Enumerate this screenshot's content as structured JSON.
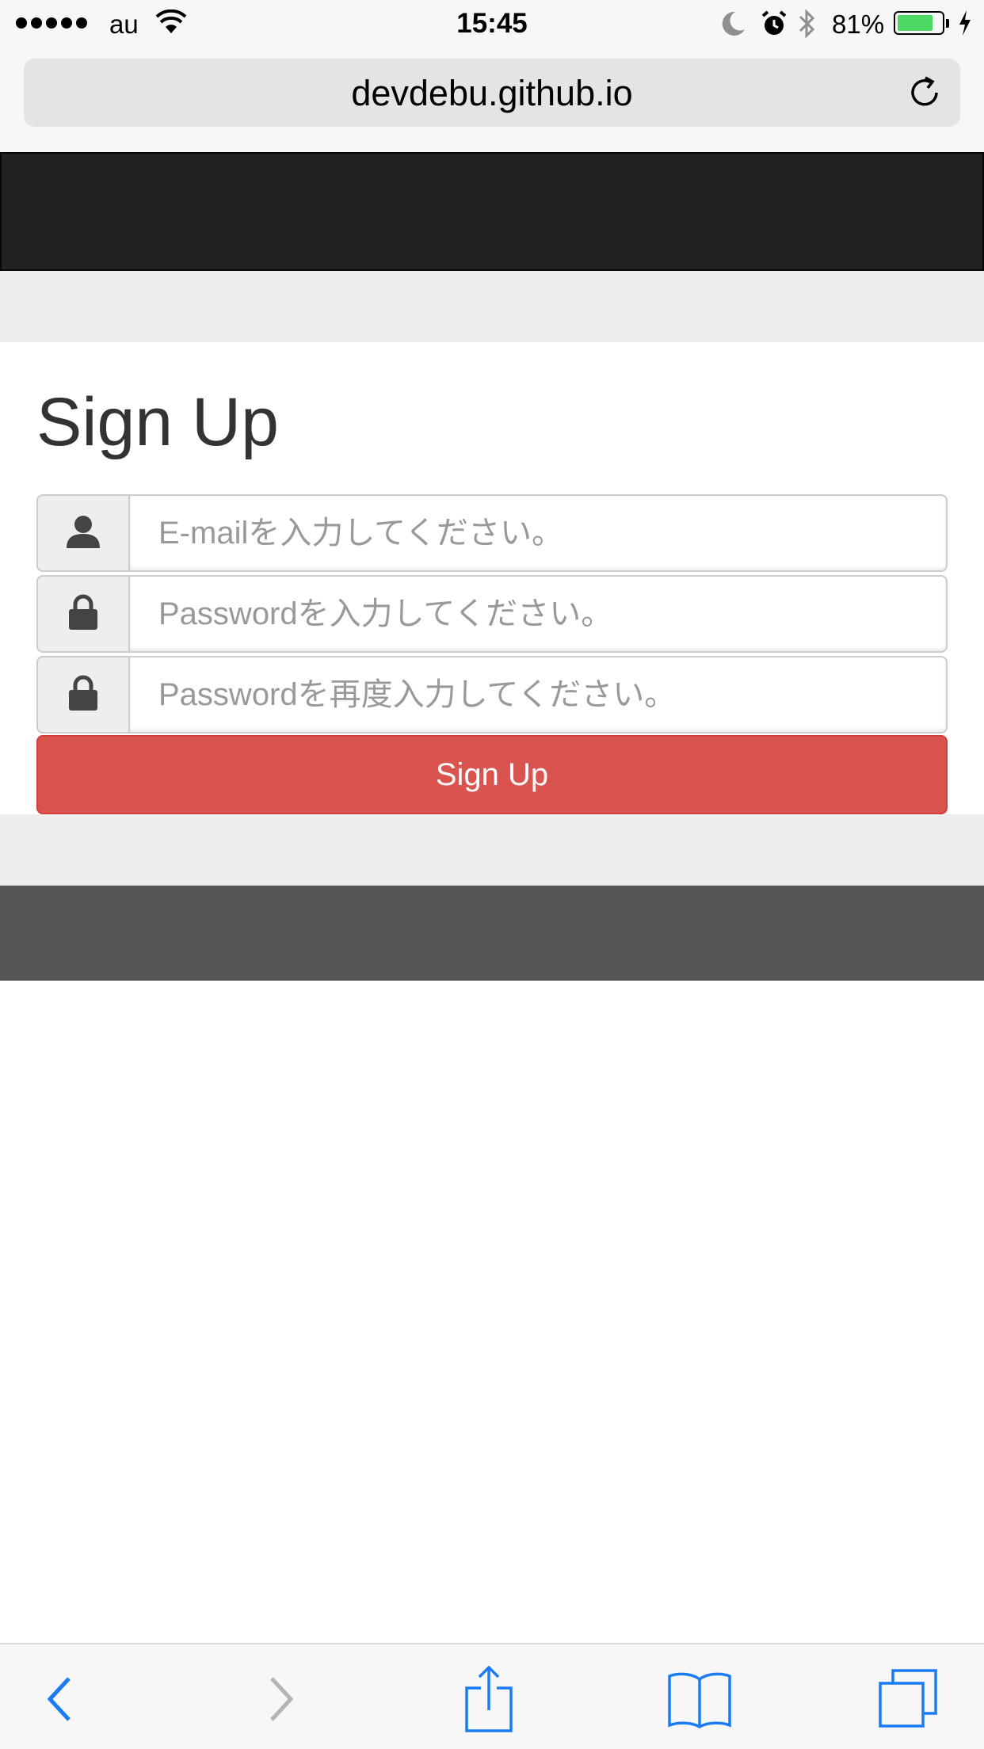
{
  "status_bar": {
    "carrier": "au",
    "time": "15:45",
    "battery_percent": "81%",
    "battery_level": 0.81
  },
  "browser": {
    "url": "devdebu.github.io"
  },
  "signup_form": {
    "title": "Sign Up",
    "email_placeholder": "E-mailを入力してください。",
    "password_placeholder": "Passwordを入力してください。",
    "password_confirm_placeholder": "Passwordを再度入力してください。",
    "submit_label": "Sign Up"
  },
  "icons": {
    "email_addon": "user-icon",
    "password_addon": "lock-icon",
    "password_confirm_addon": "lock-icon",
    "toolbar": [
      "back-icon",
      "forward-icon",
      "share-icon",
      "bookmarks-icon",
      "tabs-icon"
    ]
  },
  "colors": {
    "navbar": "#222222",
    "footer": "#555555",
    "danger_button": "#d9534f",
    "ios_blue": "#1a7cf5",
    "battery_green": "#4cd964"
  }
}
